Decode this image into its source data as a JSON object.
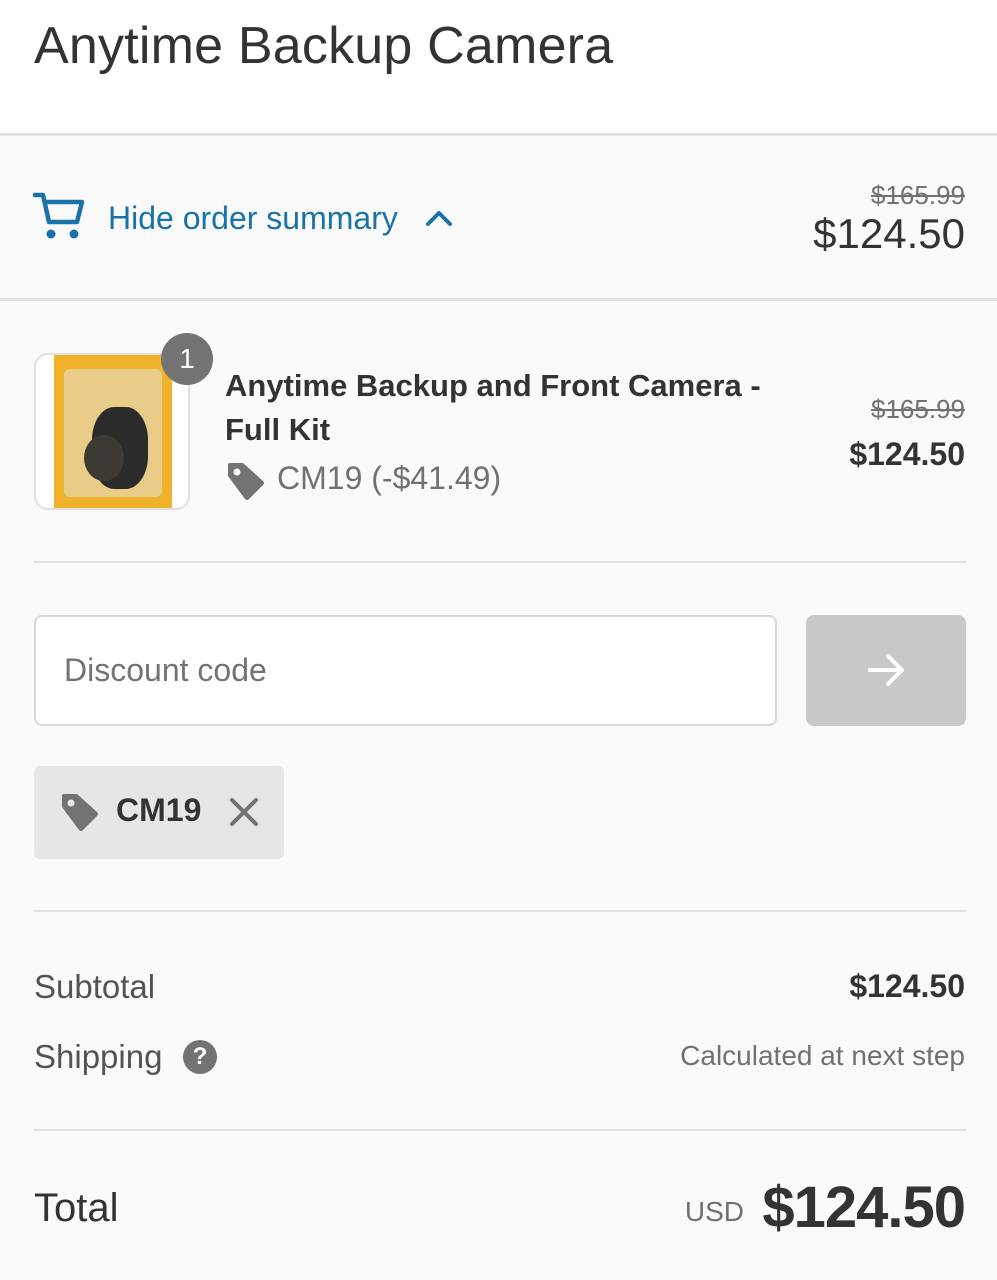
{
  "header": {
    "store_name": "Anytime Backup Camera"
  },
  "summary_toggle": {
    "label": "Hide order summary",
    "compare_at_price": "$165.99",
    "price": "$124.50",
    "icon": "cart-icon",
    "chevron_icon": "chevron-up-icon"
  },
  "line_item": {
    "quantity": "1",
    "name": "Anytime Backup and Front Camera - Full Kit",
    "discount": "CM19 (-$41.49)",
    "compare_at_price": "$165.99",
    "price": "$124.50"
  },
  "discount_form": {
    "placeholder": "Discount code",
    "value": "",
    "apply_icon": "arrow-right-icon"
  },
  "applied_discount": {
    "code": "CM19",
    "remove_icon": "close-icon"
  },
  "totals": {
    "subtotal_label": "Subtotal",
    "subtotal_value": "$124.50",
    "shipping_label": "Shipping",
    "shipping_help": "?",
    "shipping_value": "Calculated at next step",
    "total_label": "Total",
    "currency": "USD",
    "total_value": "$124.50"
  },
  "colors": {
    "link": "#1a73a8",
    "muted_text": "#717171",
    "badge": "#737373",
    "button_disabled": "#c8c8c8"
  }
}
